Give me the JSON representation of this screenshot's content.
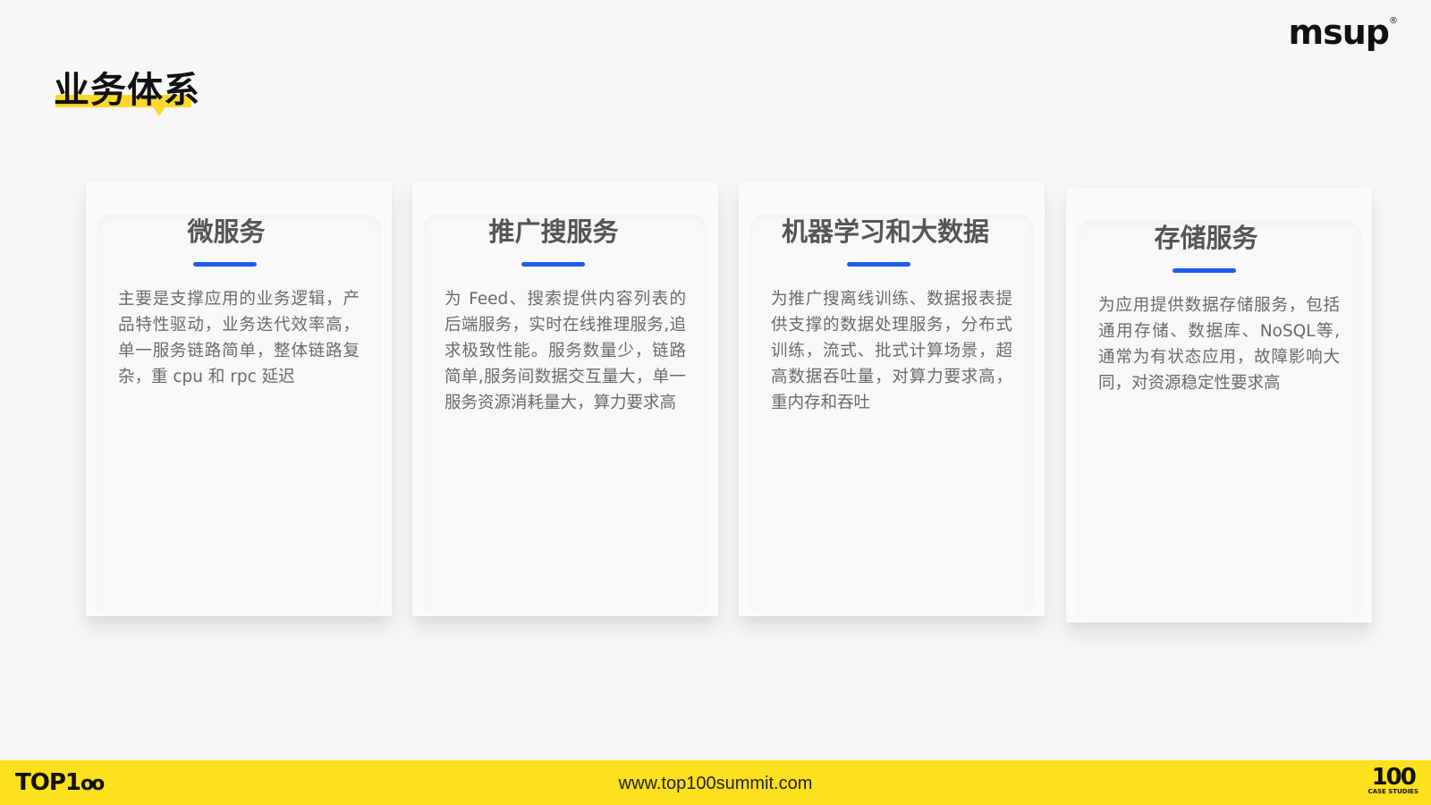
{
  "header": {
    "logo_text": "msup",
    "logo_mark": "®",
    "title": "业务体系"
  },
  "cards": [
    {
      "title": "微服务",
      "description": "主要是支撑应用的业务逻辑，产品特性驱动，业务迭代效率高，单一服务链路简单，整体链路复杂，重 cpu 和 rpc 延迟"
    },
    {
      "title": "推广搜服务",
      "description": "为 Feed、搜索提供内容列表的后端服务，实时在线推理服务,追求极致性能。服务数量少，链路简单,服务间数据交互量大，单一服务资源消耗量大，算力要求高"
    },
    {
      "title": "机器学习和大数据",
      "description": "为推广搜离线训练、数据报表提供支撑的数据处理服务，分布式训练，流式、批式计算场景，超高数据吞吐量，对算力要求高，重内存和吞吐"
    },
    {
      "title": "存储服务",
      "description": "为应用提供数据存储服务，包括通用存储、数据库、NoSQL等,通常为有状态应用，故障影响大同，对资源稳定性要求高"
    }
  ],
  "footer": {
    "left_logo": "TOP1",
    "left_logo_eyes": "oo",
    "url": "www.top100summit.com",
    "right_logo_big": "100",
    "right_logo_small": "CASE STUDIES"
  },
  "colors": {
    "accent_blue": "#1f5cf0",
    "highlight_yellow": "#fbd92a",
    "footer_yellow": "#fde01e"
  }
}
